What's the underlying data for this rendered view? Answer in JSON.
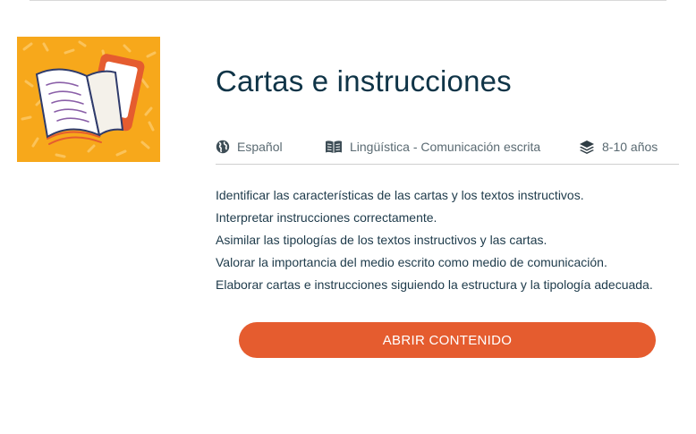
{
  "course": {
    "title": "Cartas e instrucciones",
    "thumbnail_icon": "book-and-tablet-illustration"
  },
  "meta": {
    "language": {
      "icon": "globe-icon",
      "label": "Español"
    },
    "area": {
      "icon": "open-book-icon",
      "label": "Lingüística - Comunicación escrita"
    },
    "age": {
      "icon": "layers-icon",
      "label": "8-10 años"
    }
  },
  "objectives": [
    "Identificar las características de las cartas y los textos instructivos.",
    "Interpretar instrucciones correctamente.",
    "Asimilar las tipologías de los textos instructivos y las cartas.",
    "Valorar la importancia del medio escrito como medio de comunicación.",
    "Elaborar cartas e instrucciones siguiendo la estructura y la tipología adecuada."
  ],
  "actions": {
    "open_label": "ABRIR CONTENIDO"
  },
  "colors": {
    "thumbnail_bg": "#f7a81b",
    "button_bg": "#e55c2f",
    "title": "#0f3447"
  }
}
